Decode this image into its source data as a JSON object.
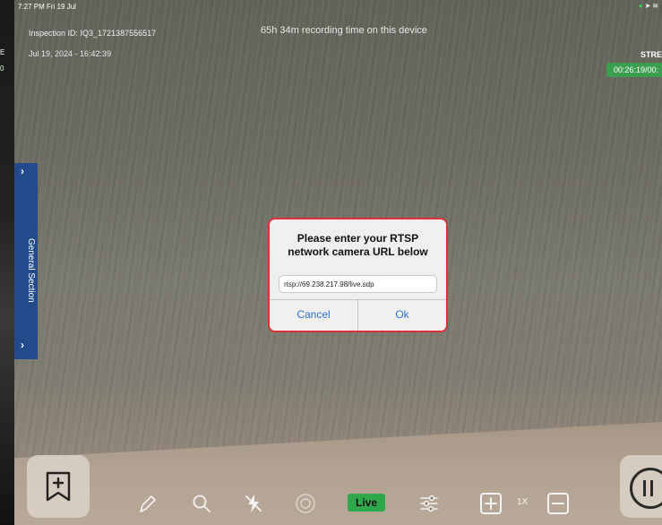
{
  "status": {
    "time_date": "7:27 PM  Fri 19 Jul"
  },
  "left_slice": {
    "chars": [
      "E",
      "0"
    ]
  },
  "overlay": {
    "inspection_id": "Inspection ID: IQ3_1721387556517",
    "timestamp": "Jul 19, 2024 - 16:42:39",
    "recording_time": "65h 34m recording time on this device",
    "stream_label": "STRE",
    "stream_timer": "00:26:19/00:"
  },
  "side_panel": {
    "label": "General Section"
  },
  "dialog": {
    "title_line1": "Please enter your RTSP",
    "title_line2": "network camera URL below",
    "input_value": "rtsp://69.238.217.98/live.sdp",
    "cancel_label": "Cancel",
    "ok_label": "Ok"
  },
  "toolbar": {
    "live_label": "Live",
    "zoom_level": "1X"
  },
  "colors": {
    "accent": "#2a74e0",
    "live": "#2ea84a",
    "timer_badge": "#3b9e4f",
    "side_panel": "#234b8c",
    "dialog_border": "#d9323a"
  },
  "icons": [
    "bookmark-add-icon",
    "pen-icon",
    "search-icon",
    "flash-off-icon",
    "camera-capture-icon",
    "sliders-icon",
    "zoom-in-icon",
    "zoom-out-icon",
    "pause-icon"
  ]
}
